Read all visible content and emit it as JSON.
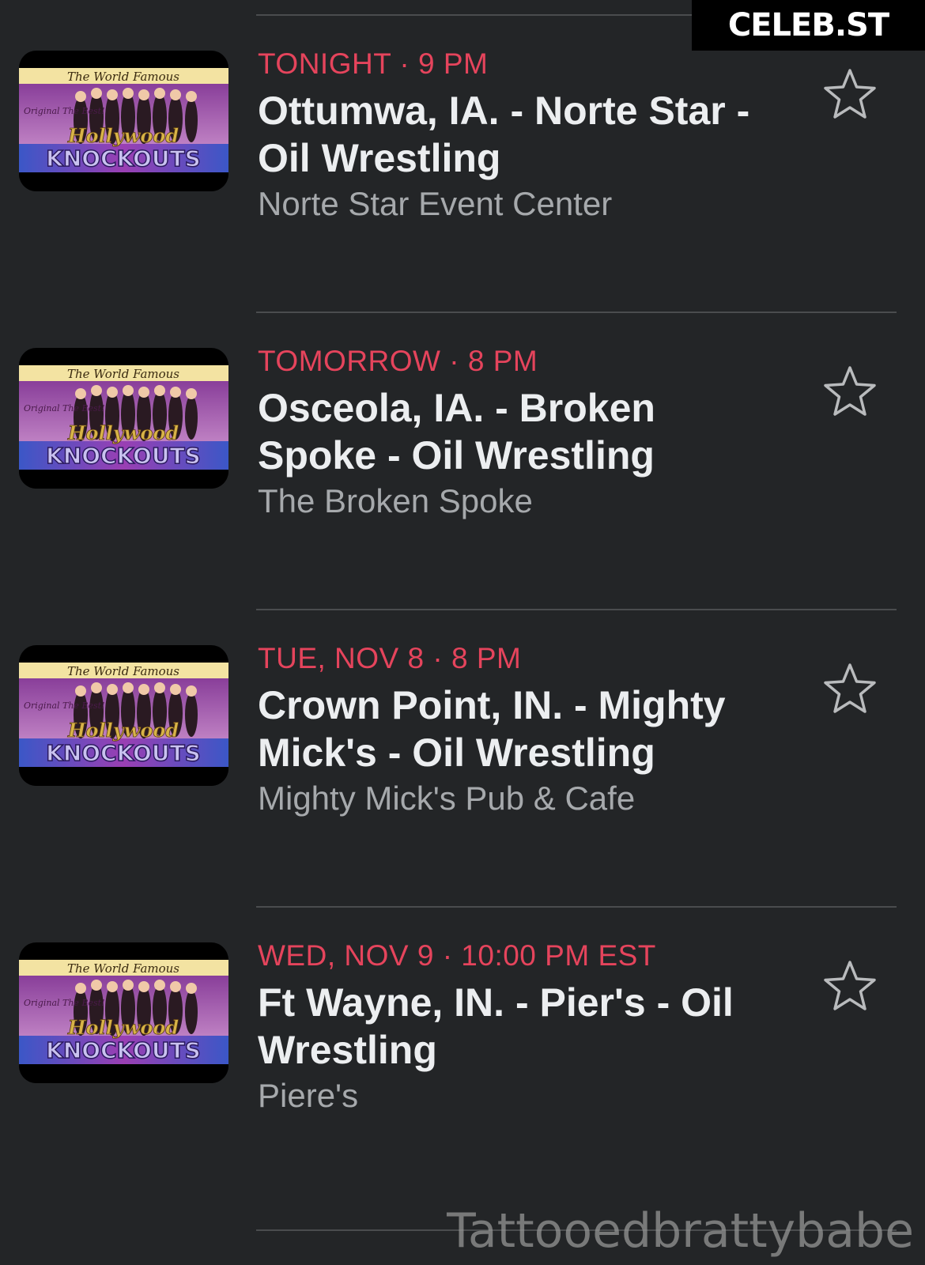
{
  "watermarks": {
    "top": "CELEB.ST",
    "bottom": "Tattooedbrattybabe"
  },
  "thumbnail": {
    "title_top": "The World Famous",
    "title_main": "KNOCKOUTS",
    "script": "Hollywood",
    "side_left": "Original The Best!"
  },
  "colors": {
    "background": "#232527",
    "accent": "#e5445c",
    "title": "#eceef0",
    "venue": "#a6a9ac"
  },
  "events": [
    {
      "when": "TONIGHT · 9 PM",
      "title": "Ottumwa, IA. - Norte Star - Oil Wrestling",
      "venue": "Norte Star Event Center",
      "icon": "star-outline-icon"
    },
    {
      "when": "TOMORROW · 8 PM",
      "title": "Osceola, IA. - Broken Spoke - Oil Wrestling",
      "venue": "The Broken Spoke",
      "icon": "star-outline-icon"
    },
    {
      "when": "TUE, NOV 8 · 8 PM",
      "title": "Crown Point, IN. - Mighty Mick's - Oil Wrestling",
      "venue": "Mighty Mick's Pub & Cafe",
      "icon": "star-outline-icon"
    },
    {
      "when": "WED, NOV 9 · 10:00 PM EST",
      "title": "Ft Wayne, IN. - Pier's - Oil Wrestling",
      "venue": "Piere's",
      "icon": "star-outline-icon"
    }
  ]
}
